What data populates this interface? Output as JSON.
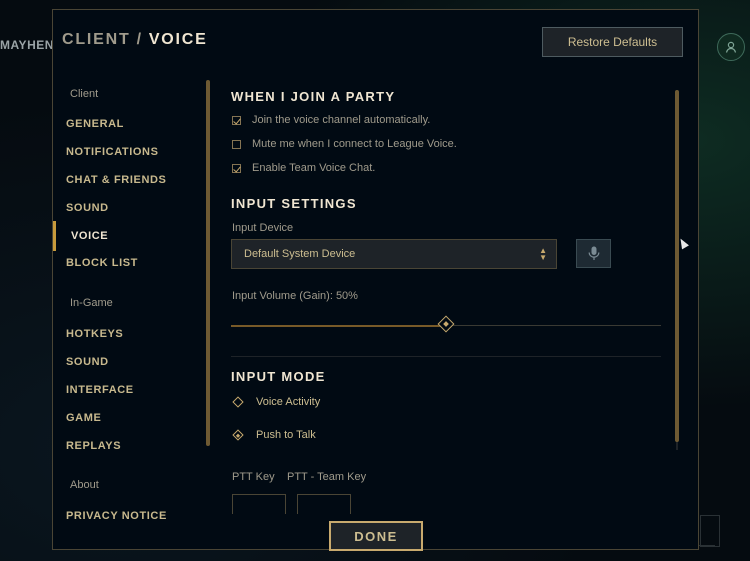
{
  "background": {
    "partial_label": "MAYHEN"
  },
  "header": {
    "breadcrumb_parent": "CLIENT",
    "breadcrumb_sep": "/",
    "breadcrumb_current": "VOICE",
    "restore_label": "Restore Defaults"
  },
  "sidebar": {
    "client_section": "Client",
    "client_items": [
      "GENERAL",
      "NOTIFICATIONS",
      "CHAT & FRIENDS",
      "SOUND",
      "VOICE",
      "BLOCK LIST"
    ],
    "ingame_section": "In-Game",
    "ingame_items": [
      "HOTKEYS",
      "SOUND",
      "INTERFACE",
      "GAME",
      "REPLAYS"
    ],
    "about_section": "About",
    "about_items": [
      "PRIVACY NOTICE"
    ],
    "active_item": "VOICE"
  },
  "party": {
    "title": "WHEN I JOIN A PARTY",
    "options": [
      {
        "label": "Join the voice channel automatically.",
        "checked": true
      },
      {
        "label": "Mute me when I connect to League Voice.",
        "checked": false
      },
      {
        "label": "Enable Team Voice Chat.",
        "checked": true
      }
    ]
  },
  "input_settings": {
    "title": "INPUT SETTINGS",
    "device_label": "Input Device",
    "device_value": "Default System Device",
    "volume_label": "Input Volume (Gain): 50%",
    "volume_value": 0.5
  },
  "input_mode": {
    "title": "INPUT MODE",
    "options": [
      {
        "label": "Voice Activity",
        "selected": false
      },
      {
        "label": "Push to Talk",
        "selected": true
      }
    ],
    "ptt_key_label": "PTT Key",
    "ptt_team_key_label": "PTT - Team Key"
  },
  "footer": {
    "done_label": "DONE"
  },
  "colors": {
    "gold": "#c8aa6e",
    "gold_text": "#cdbe91",
    "bright_text": "#f0e6d2",
    "muted_text": "#a09b8c",
    "panel_bg": "#010a13"
  },
  "icons": {
    "mic": "microphone-icon",
    "avatar": "friend-avatar-icon",
    "select": "chevron-updown-icon"
  }
}
